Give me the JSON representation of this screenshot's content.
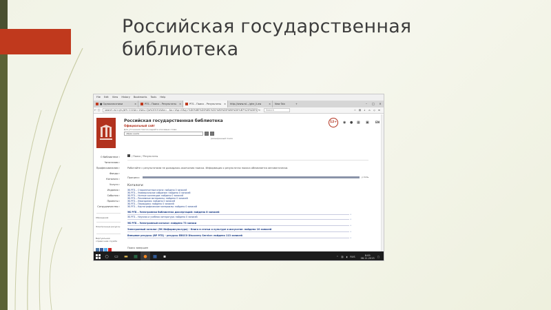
{
  "slide": {
    "title": "Российская государственная библиотека"
  },
  "browser": {
    "menu": [
      "File",
      "Edit",
      "View",
      "History",
      "Bookmarks",
      "Tools",
      "Help"
    ],
    "tabs": [
      {
        "label": "■ Одноклассники",
        "active": false
      },
      {
        "label": "РГБ - Поиск - Результаты",
        "active": false
      },
      {
        "label": "РГБ - Поиск - Результаты",
        "active": true
      },
      {
        "label": "http://www.rsl.../ghe_li.aw",
        "active": false
      },
      {
        "label": "New Tab",
        "active": false
      }
    ],
    "url": "search.rsl.ru/ru/#f=111&k=1&ks=Qa%20151&0a=...&s=1&p=0&q=%D0%BE%D0%B1%D1%80%D0%B0%D0%B7%20%D0%BA%D0%BD%D0%B8%D0%B3%D0%B8",
    "search_placeholder": "Search"
  },
  "site": {
    "title": "Российская государственная библиотека",
    "subtitle": "Официальный сайт",
    "hint": "Для уточнения поиска задайте ключевые слова",
    "search_value": "образ книги",
    "advanced": "расширенный поиск",
    "age": "12+",
    "lang": "EN"
  },
  "sidebar": {
    "items": [
      "О библиотеке",
      "Читателям",
      "Профессионалам",
      "Фонды",
      "Каталоги",
      "Услуги",
      "Издания",
      "События",
      "Проекты",
      "Сотрудничество"
    ],
    "extras": [
      "Обращения",
      "Электронные ресурсы",
      "Виртуальная справочная служба"
    ]
  },
  "content": {
    "breadcrumb": "/ Поиск / Результаты",
    "info": "Работайте с результатами не дожидаясь окончания поиска. Информация о результатах поиска обновляется автоматически.",
    "progress_label": "Прогресс:",
    "progress_percent": 100,
    "progress_tail": "у.поль",
    "catalogs_title": "Каталоги:",
    "catalogs": [
      "ЭБ РГБ – Старопечатные книги: найдено 0 записей",
      "ЭБ РГБ – Универсальное собрание: найдено 0 записей",
      "ЭБ РГБ – Нотные коллекции: найдено 0 записей",
      "ЭБ РГБ – Реклемные материалы: найдено 0 записей",
      "ЭБ РГБ – Изоиздания: найдено 0 записей",
      "ЭБ РГБ – Периодика: найдено 0 записей",
      "ЭБ РГБ – Картографические материалы: найдено 0 записей"
    ],
    "catalogs_ruled": [
      {
        "text": "ЭБ РГБ – Электронная библиотека диссертаций: найдено 8 записей",
        "bold": true
      },
      {
        "text": "ЭБ РГБ – Научная и учебная литература: найдено 0 записей",
        "bold": false
      },
      {
        "text": "ЭБ РГБ – Электронный каталог: найдено 73 записи",
        "bold": true
      },
      {
        "text": "Электронный каталог (ЭК Информкультура) - Книга в статьи о культуре и искусстве: найдено 10 записей",
        "bold": true
      },
      {
        "text": "Внешние ресурсы (ВР РГБ) - ресурсы EBSCO Discovery Service: найдено 113 записей",
        "bold": true
      }
    ],
    "done": "Поиск завершен"
  },
  "taskbar": {
    "icons": [
      "search-icon",
      "task-view-icon",
      "explorer-icon",
      "excel-icon",
      "firefox-icon",
      "word-icon",
      "terminal-icon"
    ],
    "lang": "RUS",
    "time": "8:09",
    "date": "08.11.2015"
  },
  "colors": {
    "accent_red": "#c0391d",
    "sidebar_olive": "#5b6236",
    "link_blue": "#1d3f8a"
  }
}
